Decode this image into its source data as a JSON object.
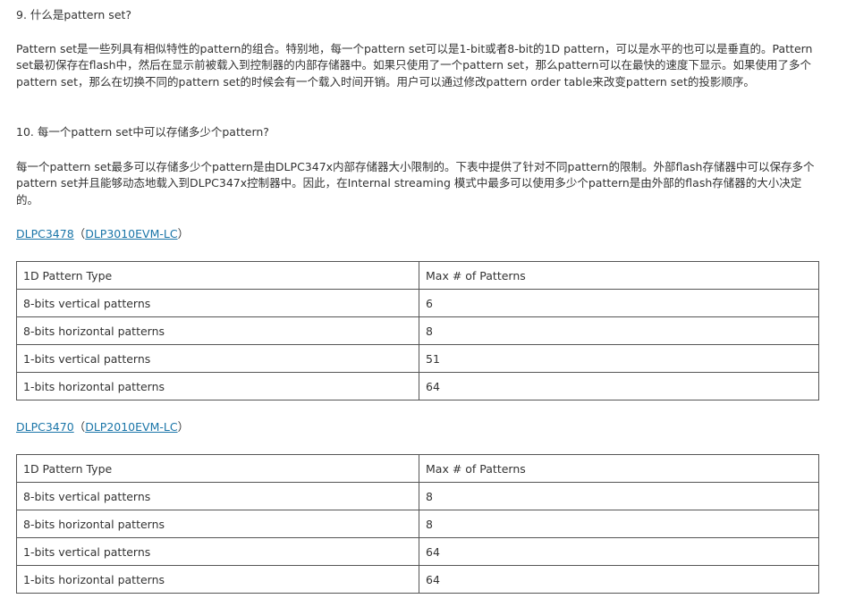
{
  "q9": {
    "title": "9. 什么是pattern set?"
  },
  "p9": {
    "text": "Pattern set是一些列具有相似特性的pattern的组合。特别地，每一个pattern set可以是1-bit或者8-bit的1D pattern，可以是水平的也可以是垂直的。Pattern set最初保存在flash中，然后在显示前被载入到控制器的内部存储器中。如果只使用了一个pattern set，那么pattern可以在最快的速度下显示。如果使用了多个pattern set，那么在切换不同的pattern set的时候会有一个载入时间开销。用户可以通过修改pattern order table来改变pattern set的投影顺序。"
  },
  "q10": {
    "title": "10. 每一个pattern set中可以存储多少个pattern?"
  },
  "p10": {
    "text": "每一个pattern set最多可以存储多少个pattern是由DLPC347x内部存储器大小限制的。下表中提供了针对不同pattern的限制。外部flash存储器中可以保存多个pattern set并且能够动态地载入到DLPC347x控制器中。因此，在Internal streaming 模式中最多可以使用多少个pattern是由外部的flash存储器的大小决定的。"
  },
  "section1": {
    "controller": "DLPC3478",
    "open": "（",
    "evm": "DLP3010EVM-LC",
    "close": "）",
    "table": {
      "header": [
        "1D Pattern Type",
        "Max # of Patterns"
      ],
      "rows": [
        [
          "8-bits vertical patterns",
          "6"
        ],
        [
          "8-bits horizontal patterns",
          "8"
        ],
        [
          "1-bits vertical patterns",
          "51"
        ],
        [
          "1-bits horizontal patterns",
          "64"
        ]
      ]
    }
  },
  "section2": {
    "controller": "DLPC3470",
    "open": "（",
    "evm": "DLP2010EVM-LC",
    "close": "）",
    "table": {
      "header": [
        "1D Pattern Type",
        "Max # of Patterns"
      ],
      "rows": [
        [
          "8-bits vertical patterns",
          "8"
        ],
        [
          "8-bits horizontal patterns",
          "8"
        ],
        [
          "1-bits vertical patterns",
          "64"
        ],
        [
          "1-bits horizontal patterns",
          "64"
        ]
      ]
    }
  },
  "colors": {
    "text": "#333333",
    "link": "#1a75a8",
    "border": "#555555"
  }
}
